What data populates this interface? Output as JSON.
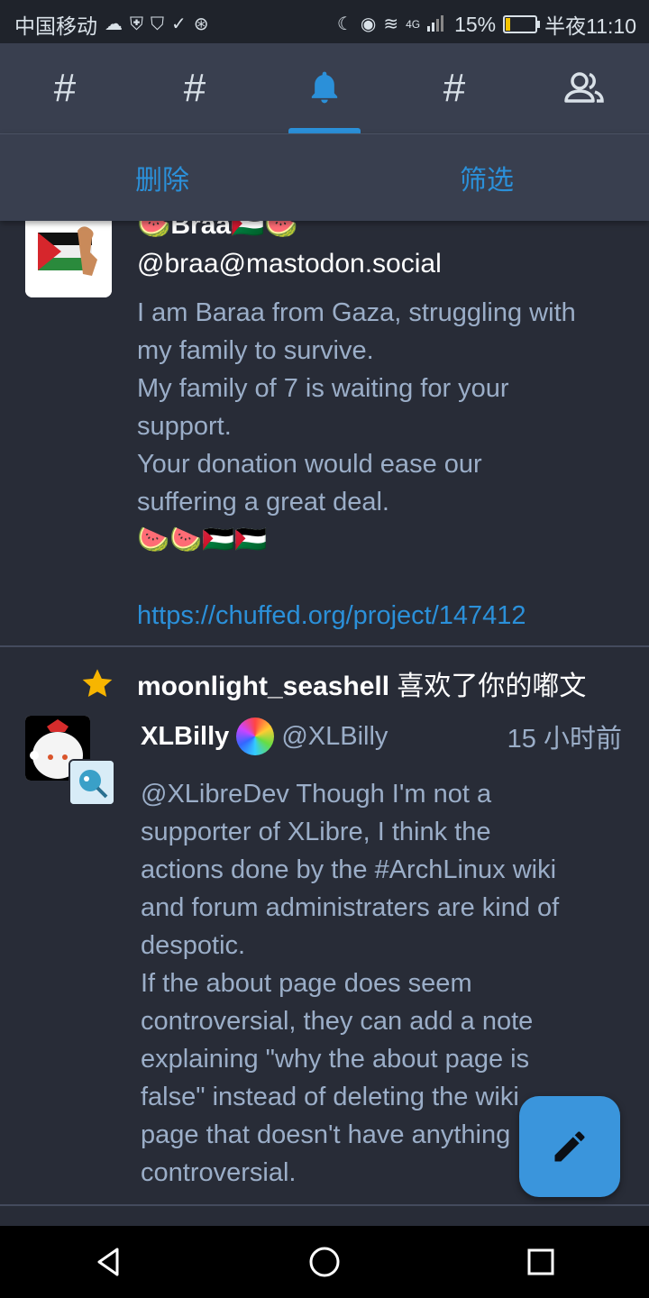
{
  "status_bar": {
    "carrier": "中国移动",
    "network": "4G",
    "battery": "15%",
    "battery_level": 0.15,
    "time": "半夜11:10"
  },
  "tabs": [
    {
      "icon": "hashtag-icon",
      "label": "#"
    },
    {
      "icon": "hashtag-icon",
      "label": "#"
    },
    {
      "icon": "bell-icon",
      "label": "",
      "active": true
    },
    {
      "icon": "hashtag-icon",
      "label": "#"
    },
    {
      "icon": "people-icon",
      "label": ""
    }
  ],
  "filter_bar": {
    "delete_label": "删除",
    "filter_label": "筛选"
  },
  "post1": {
    "display_name": "🍉Braa🇵🇸🍉",
    "handle": "@braa@mastodon.social",
    "lines": [
      "I am Baraa from Gaza, struggling with",
      "my family to survive.",
      "My family of 7 is waiting for your",
      "support.",
      "Your donation would ease our",
      "suffering a great deal.",
      "🍉🍉🇵🇸🇵🇸"
    ],
    "link": "https://chuffed.org/project/147412"
  },
  "notification": {
    "actor": "moonlight_seashell",
    "action": " 喜欢了你的嘟文"
  },
  "post2": {
    "display_name": "XLBilly",
    "handle": "@XLBilly",
    "time": "15 小时前",
    "lines": [
      "@XLibreDev Though I'm not a",
      "supporter of XLibre, I think the",
      "actions done by the #ArchLinux wiki",
      "and forum administraters are kind of",
      "despotic.",
      "If the about page does seem",
      "controversial, they can add a note",
      "explaining \"why the about page is",
      "false\" instead of deleting the wiki",
      "page that doesn't have anything",
      "controversial."
    ]
  },
  "fab": {
    "icon": "pencil-icon"
  },
  "colors": {
    "background": "#282c37",
    "bar": "#393f4f",
    "accent": "#2b90d9",
    "muted_text": "#9baec8",
    "star": "#f7b500"
  }
}
